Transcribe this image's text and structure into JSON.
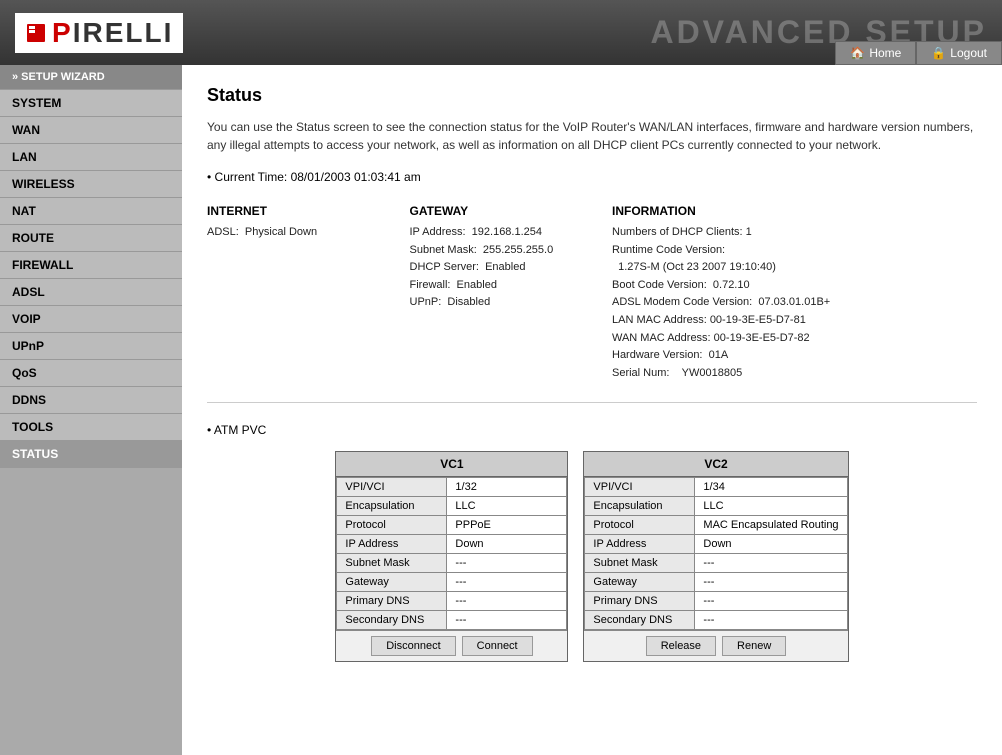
{
  "header": {
    "title": "ADVANCED SETUP",
    "logo_text": "IRELLI",
    "home_label": "Home",
    "logout_label": "Logout"
  },
  "sidebar": {
    "items": [
      {
        "label": "» SETUP WIZARD",
        "id": "setup-wizard",
        "active": false,
        "top": true
      },
      {
        "label": "SYSTEM",
        "id": "system",
        "active": false
      },
      {
        "label": "WAN",
        "id": "wan",
        "active": false
      },
      {
        "label": "LAN",
        "id": "lan",
        "active": false
      },
      {
        "label": "WIRELESS",
        "id": "wireless",
        "active": false
      },
      {
        "label": "NAT",
        "id": "nat",
        "active": false
      },
      {
        "label": "ROUTE",
        "id": "route",
        "active": false
      },
      {
        "label": "FIREWALL",
        "id": "firewall",
        "active": false
      },
      {
        "label": "ADSL",
        "id": "adsl",
        "active": false
      },
      {
        "label": "VOIP",
        "id": "voip",
        "active": false
      },
      {
        "label": "UPnP",
        "id": "upnp",
        "active": false
      },
      {
        "label": "QoS",
        "id": "qos",
        "active": false
      },
      {
        "label": "DDNS",
        "id": "ddns",
        "active": false
      },
      {
        "label": "TOOLS",
        "id": "tools",
        "active": false
      },
      {
        "label": "STATUS",
        "id": "status",
        "active": true
      }
    ]
  },
  "main": {
    "page_title": "Status",
    "description": "You can use the Status screen to see the connection status for the VoIP Router's WAN/LAN interfaces, firmware and hardware version numbers, any illegal attempts to access your network, as well as information on all DHCP client PCs currently connected to your network.",
    "current_time_label": "Current Time:",
    "current_time_value": "08/01/2003 01:03:41 am",
    "internet": {
      "title": "INTERNET",
      "adsl_label": "ADSL:",
      "adsl_value": "Physical Down"
    },
    "gateway": {
      "title": "GATEWAY",
      "ip_label": "IP Address:",
      "ip_value": "192.168.1.254",
      "subnet_label": "Subnet Mask:",
      "subnet_value": "255.255.255.0",
      "dhcp_label": "DHCP Server:",
      "dhcp_value": "Enabled",
      "firewall_label": "Firewall:",
      "firewall_value": "Enabled",
      "upnp_label": "UPnP:",
      "upnp_value": "Disabled"
    },
    "information": {
      "title": "INFORMATION",
      "dhcp_clients_label": "Numbers of DHCP Clients:",
      "dhcp_clients_value": "1",
      "runtime_label": "Runtime Code Version:",
      "runtime_value": "1.27S-M (Oct 23 2007 19:10:40)",
      "boot_label": "Boot Code Version:",
      "boot_value": "0.72.10",
      "adsl_modem_label": "ADSL Modem Code Version:",
      "adsl_modem_value": "07.03.01.01B+",
      "lan_mac_label": "LAN MAC Address:",
      "lan_mac_value": "00-19-3E-E5-D7-81",
      "wan_mac_label": "WAN MAC Address:",
      "wan_mac_value": "00-19-3E-E5-D7-82",
      "hw_version_label": "Hardware Version:",
      "hw_version_value": "01A",
      "serial_label": "Serial Num:",
      "serial_value": "YW0018805"
    },
    "atm_title": "ATM PVC",
    "vc1": {
      "header": "VC1",
      "rows": [
        {
          "label": "VPI/VCI",
          "value": "1/32"
        },
        {
          "label": "Encapsulation",
          "value": "LLC"
        },
        {
          "label": "Protocol",
          "value": "PPPoE"
        },
        {
          "label": "IP Address",
          "value": "Down"
        },
        {
          "label": "Subnet Mask",
          "value": "---"
        },
        {
          "label": "Gateway",
          "value": "---"
        },
        {
          "label": "Primary DNS",
          "value": "---"
        },
        {
          "label": "Secondary DNS",
          "value": "---"
        }
      ],
      "btn1": "Disconnect",
      "btn2": "Connect"
    },
    "vc2": {
      "header": "VC2",
      "rows": [
        {
          "label": "VPI/VCI",
          "value": "1/34"
        },
        {
          "label": "Encapsulation",
          "value": "LLC"
        },
        {
          "label": "Protocol",
          "value": "MAC Encapsulated Routing"
        },
        {
          "label": "IP Address",
          "value": "Down"
        },
        {
          "label": "Subnet Mask",
          "value": "---"
        },
        {
          "label": "Gateway",
          "value": "---"
        },
        {
          "label": "Primary DNS",
          "value": "---"
        },
        {
          "label": "Secondary DNS",
          "value": "---"
        }
      ],
      "btn1": "Release",
      "btn2": "Renew"
    }
  }
}
